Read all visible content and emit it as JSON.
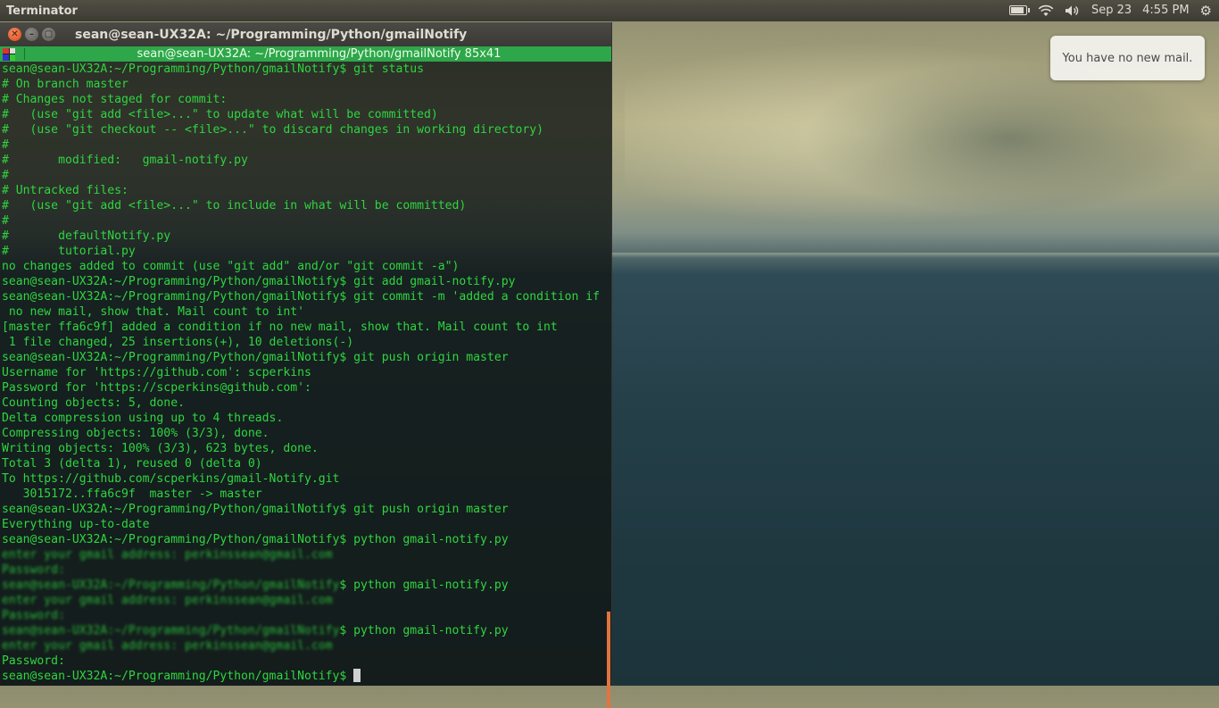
{
  "top_panel": {
    "app_title": "Terminator",
    "battery_level": 0.85,
    "date": "Sep 23",
    "time": "4:55 PM",
    "icons": [
      "battery-icon",
      "wifi-icon",
      "volume-icon",
      "settings-gear-icon"
    ]
  },
  "notification": {
    "text": "You have no new mail."
  },
  "window": {
    "title": "sean@sean-UX32A: ~/Programming/Python/gmailNotify",
    "tab_title": "sean@sean-UX32A: ~/Programming/Python/gmailNotify 85x41",
    "buttons": [
      "close-icon",
      "minimize-icon",
      "maximize-icon"
    ]
  },
  "terminal": {
    "text_color": "#2fd540",
    "lines": [
      "sean@sean-UX32A:~/Programming/Python/gmailNotify$ git status",
      "# On branch master",
      "# Changes not staged for commit:",
      "#   (use \"git add <file>...\" to update what will be committed)",
      "#   (use \"git checkout -- <file>...\" to discard changes in working directory)",
      "#",
      "#       modified:   gmail-notify.py",
      "#",
      "# Untracked files:",
      "#   (use \"git add <file>...\" to include in what will be committed)",
      "#",
      "#       defaultNotify.py",
      "#       tutorial.py",
      "no changes added to commit (use \"git add\" and/or \"git commit -a\")",
      "sean@sean-UX32A:~/Programming/Python/gmailNotify$ git add gmail-notify.py",
      "sean@sean-UX32A:~/Programming/Python/gmailNotify$ git commit -m 'added a condition if",
      " no new mail, show that. Mail count to int'",
      "[master ffa6c9f] added a condition if no new mail, show that. Mail count to int",
      " 1 file changed, 25 insertions(+), 10 deletions(-)",
      "sean@sean-UX32A:~/Programming/Python/gmailNotify$ git push origin master",
      "Username for 'https://github.com': scperkins",
      "Password for 'https://scperkins@github.com':",
      "Counting objects: 5, done.",
      "Delta compression using up to 4 threads.",
      "Compressing objects: 100% (3/3), done.",
      "Writing objects: 100% (3/3), 623 bytes, done.",
      "Total 3 (delta 1), reused 0 (delta 0)",
      "To https://github.com/scperkins/gmail-Notify.git",
      "   3015172..ffa6c9f  master -> master",
      "sean@sean-UX32A:~/Programming/Python/gmailNotify$ git push origin master",
      "Everything up-to-date",
      "sean@sean-UX32A:~/Programming/Python/gmailNotify$ python gmail-notify.py"
    ],
    "blurred_lines": [
      {
        "prefix_blur": "enter your gmail address: perkinssean@gmail.com",
        "suffix": ""
      },
      {
        "prefix_blur": "Password:",
        "suffix": ""
      },
      {
        "prefix_blur": "sean@sean-UX32A:~/Programming/Python/gmailNotify",
        "suffix": "$ python gmail-notify.py"
      },
      {
        "prefix_blur": "enter your gmail address: perkinssean@gmail.com",
        "suffix": ""
      },
      {
        "prefix_blur": "Password:",
        "suffix": ""
      },
      {
        "prefix_blur": "sean@sean-UX32A:~/Programming/Python/gmailNotify",
        "suffix": "$ python gmail-notify.py"
      },
      {
        "prefix_blur": "enter your gmail address: perkinssean@gmail.com",
        "suffix": ""
      }
    ],
    "trailing_lines": [
      "Password:"
    ],
    "prompt": "sean@sean-UX32A:~/Programming/Python/gmailNotify$ "
  }
}
